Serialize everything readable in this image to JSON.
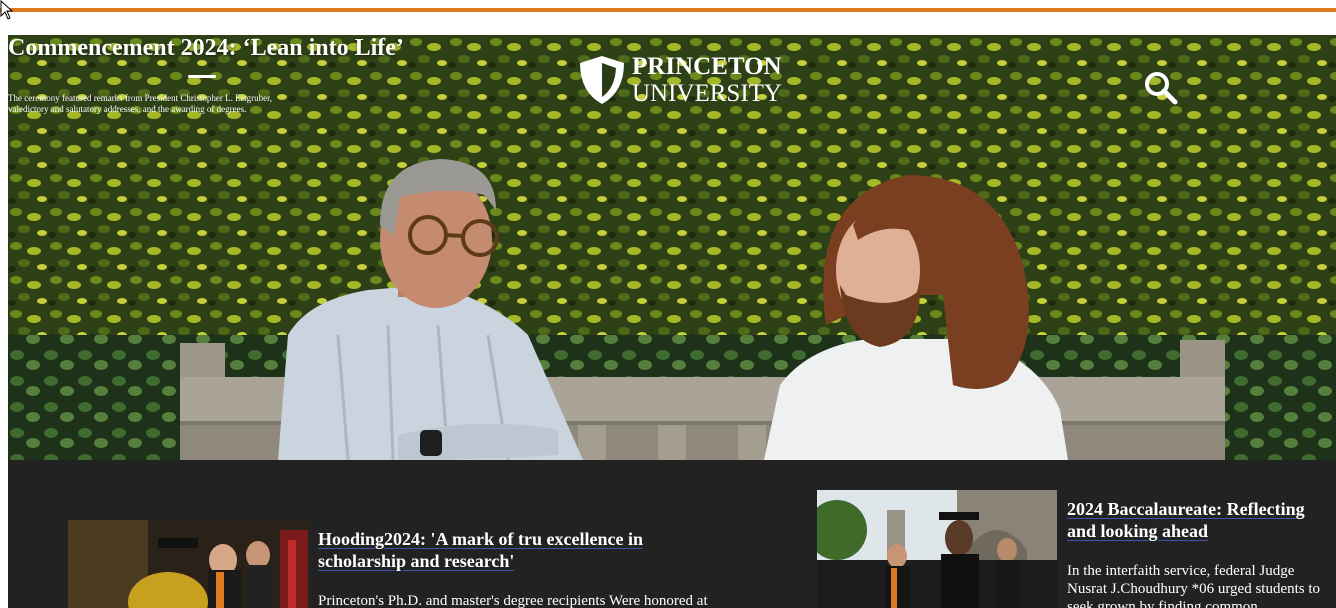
{
  "hero": {
    "title": "Commencement 2024: ‘Lean into Life’",
    "description": "The ceremony featured remarks from President Christopher L. Eisgruber, valedictory and salutatory addresses, and the awarding of degrees."
  },
  "logo": {
    "line1": "PRINCETON",
    "line2": "UNIVERSITY"
  },
  "icons": {
    "menu": "hamburger-menu-icon",
    "search": "search-icon",
    "logo": "shield-icon"
  },
  "colors": {
    "accent": "#e07a1f",
    "news_bg": "#222222",
    "link_underline": "#3c56b0"
  },
  "news": [
    {
      "title": "Hooding2024: 'A mark of tru excellence in scholarship and research'",
      "summary": "Princeton's Ph.D. and master's degree recipients Were honored at"
    },
    {
      "title": "2024 Baccalaureate: Reflecting and looking ahead",
      "summary": "In the interfaith service, federal Judge Nusrat J.Choudhury *06 urged students to seek grown by finding common"
    }
  ]
}
